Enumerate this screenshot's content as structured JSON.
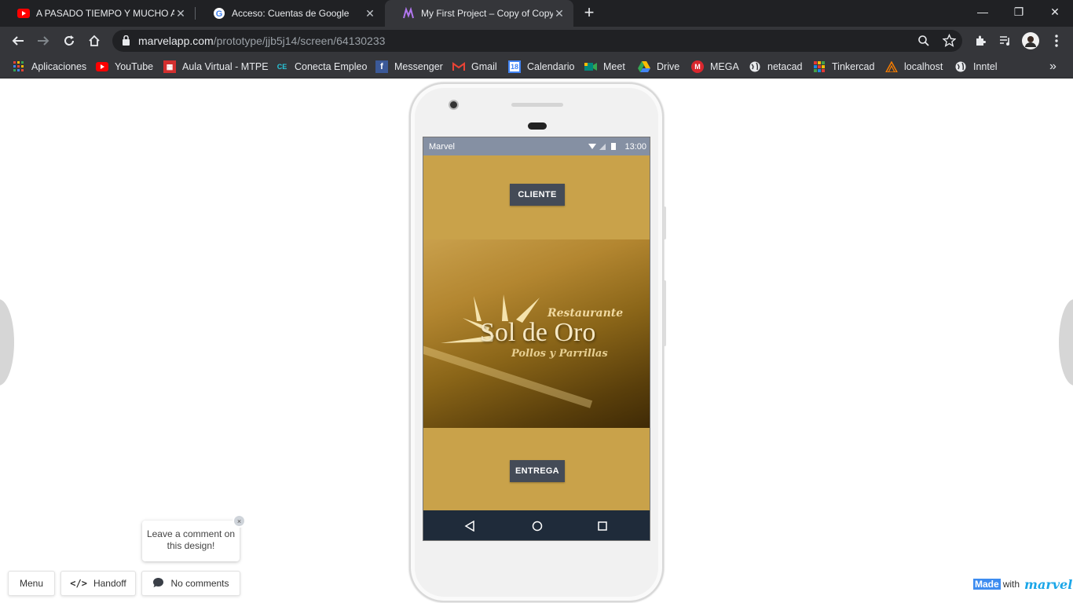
{
  "browser": {
    "tabs": [
      {
        "title": "A PASADO TIEMPO Y MUCHO A",
        "favicon": "youtube-icon",
        "active": false
      },
      {
        "title": "Acceso: Cuentas de Google",
        "favicon": "google-icon",
        "active": false
      },
      {
        "title": "My First Project – Copy of Copy o",
        "favicon": "marvel-icon",
        "active": true
      }
    ],
    "new_tab": "+",
    "url_host": "marvelapp.com",
    "url_path": "/prototype/jjb5j14/screen/64130233",
    "bookmarks": [
      {
        "label": "Aplicaciones",
        "icon": "apps-grid-icon",
        "color": "#ea4335"
      },
      {
        "label": "YouTube",
        "icon": "youtube-icon",
        "color": "#ff0000"
      },
      {
        "label": "Aula Virtual - MTPE",
        "icon": "mtpe-icon",
        "color": "#d32f2f"
      },
      {
        "label": "Conecta Empleo",
        "icon": "conecta-empleo-icon",
        "color": "#26a69a"
      },
      {
        "label": "Messenger",
        "icon": "facebook-icon",
        "color": "#3b5998"
      },
      {
        "label": "Gmail",
        "icon": "gmail-icon",
        "color": "#ea4335"
      },
      {
        "label": "Calendario",
        "icon": "calendar-icon",
        "color": "#4285f4"
      },
      {
        "label": "Meet",
        "icon": "meet-icon",
        "color": "#00897b"
      },
      {
        "label": "Drive",
        "icon": "drive-icon",
        "color": "#fbbc04"
      },
      {
        "label": "MEGA",
        "icon": "mega-icon",
        "color": "#d9272e"
      },
      {
        "label": "netacad",
        "icon": "globe-icon",
        "color": "#e8eaed"
      },
      {
        "label": "Tinkercad",
        "icon": "tinkercad-icon",
        "color": "#f4a300"
      },
      {
        "label": "localhost",
        "icon": "localhost-icon",
        "color": "#f57c00"
      },
      {
        "label": "Inntel",
        "icon": "globe-icon",
        "color": "#e8eaed"
      }
    ],
    "bookmarks_more": "»"
  },
  "phone_app": {
    "status_carrier": "Marvel",
    "status_time": "13:00",
    "button_top": "CLIENTE",
    "button_bottom": "ENTREGA",
    "logo": {
      "top": "Restaurante",
      "main": "Sol de Oro",
      "sub": "Pollos y Parrillas"
    }
  },
  "marvel_ui": {
    "comment_tip": "Leave a comment on this design!",
    "comment_tip_close": "×",
    "menu_label": "Menu",
    "handoff_label": "Handoff",
    "comments_label": "No comments",
    "made": "Made",
    "with": "with",
    "brand": "marvel"
  },
  "colors": {
    "phone_screen_bg": "#c9a24a",
    "app_button": "#444b57",
    "android_nav": "#1f2b3a",
    "status_bar": "#8590a3"
  }
}
